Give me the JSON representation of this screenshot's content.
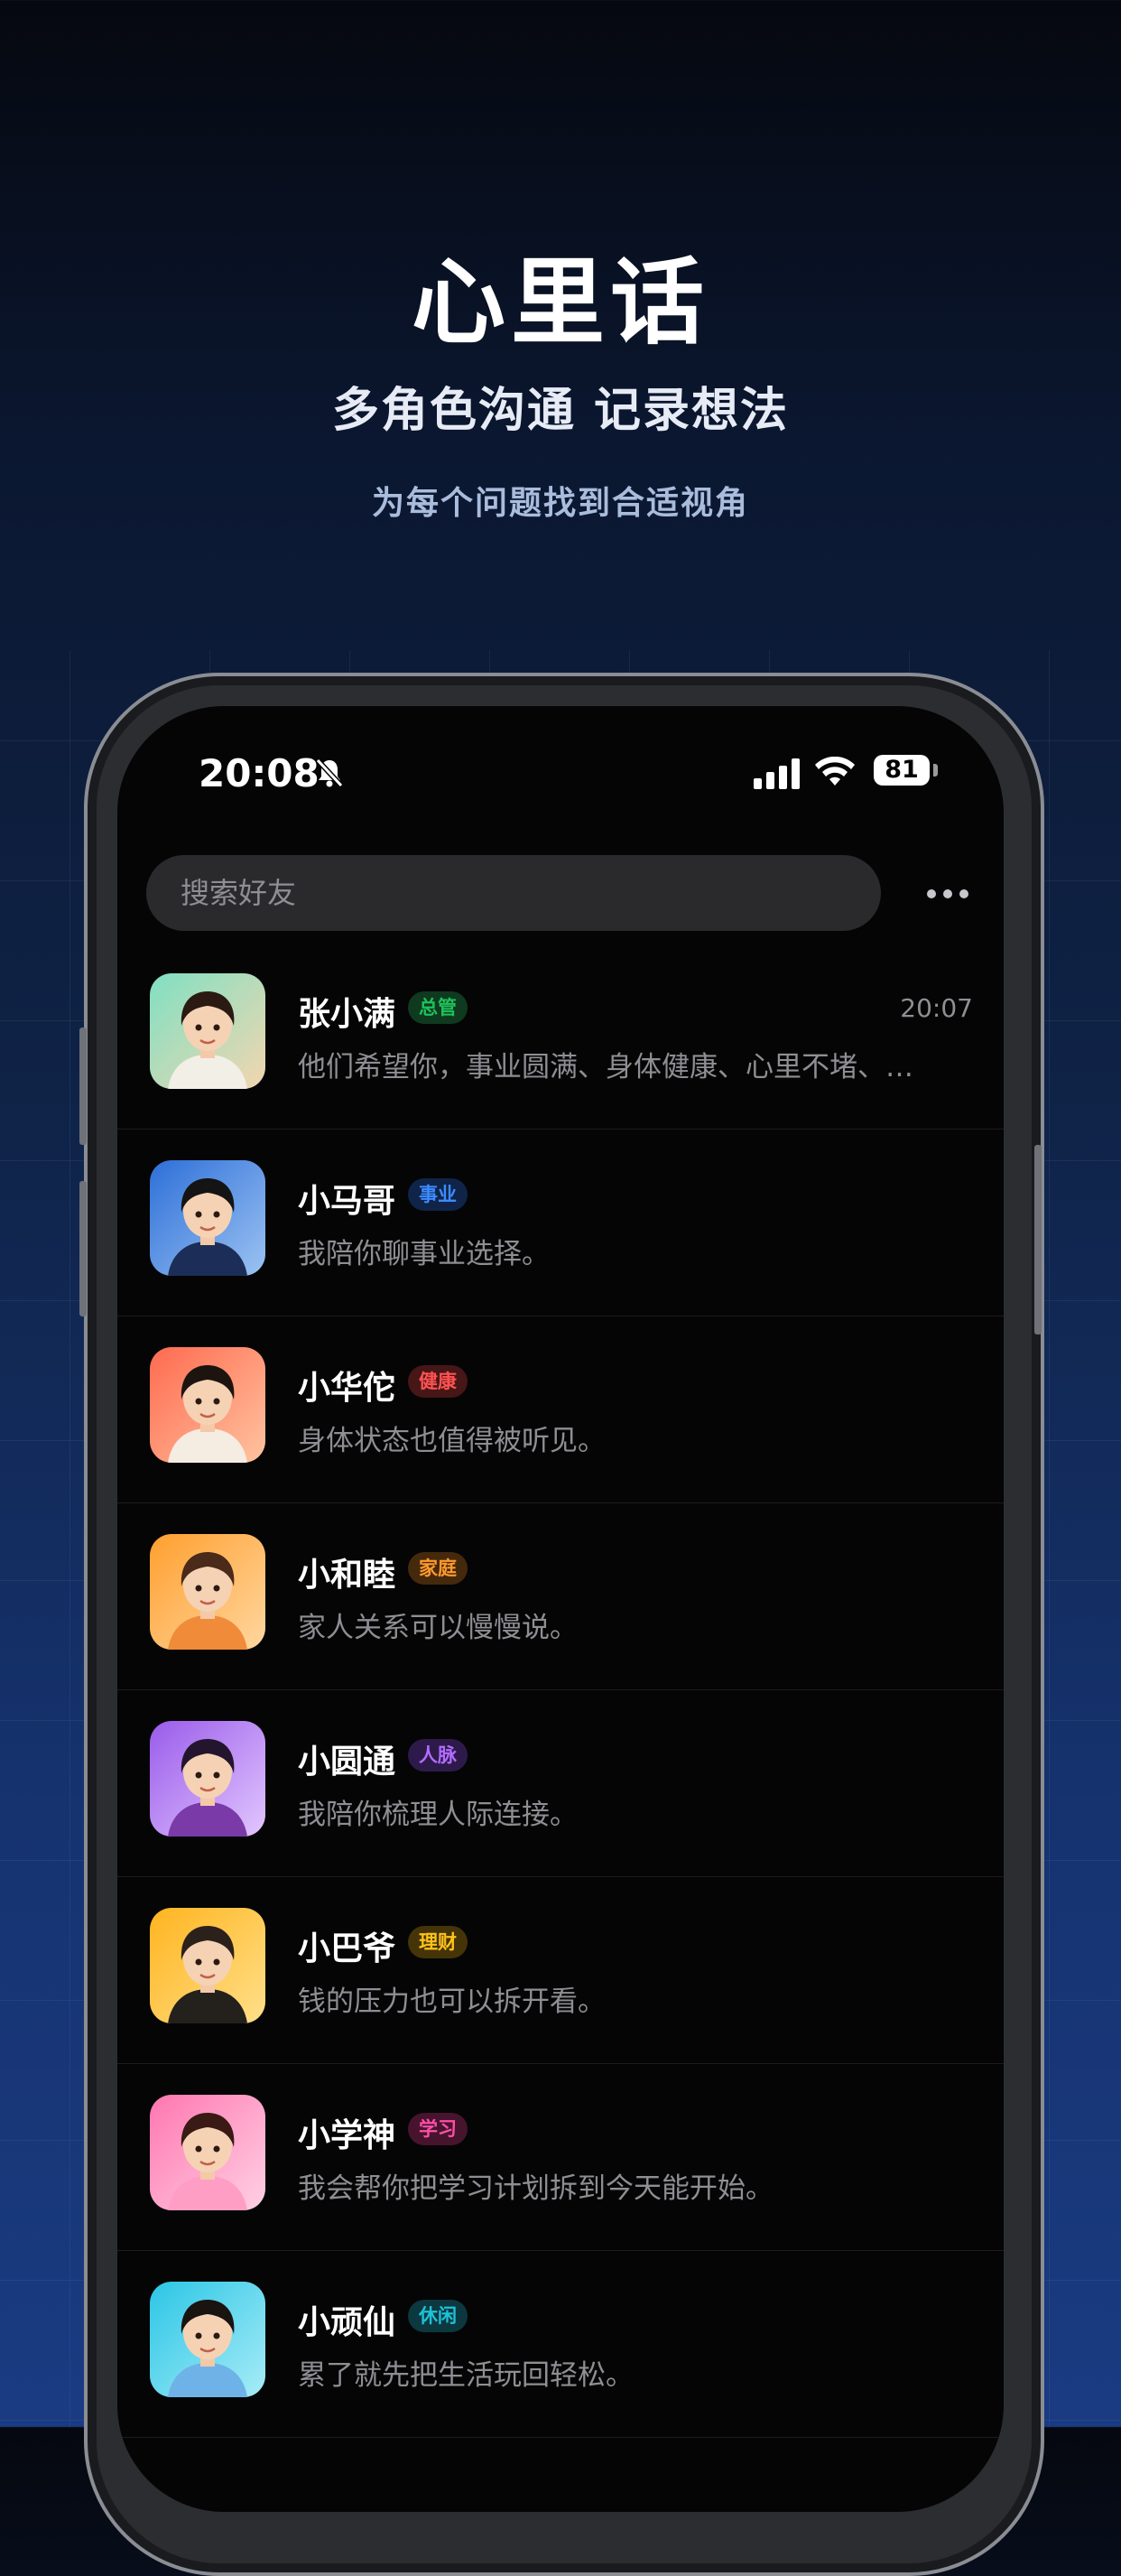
{
  "hero": {
    "title": "心里话",
    "subtitle": "多角色沟通 记录想法",
    "tagline": "为每个问题找到合适视角"
  },
  "status_bar": {
    "time": "20:08",
    "battery": "81",
    "icons": [
      "bell-slash-icon",
      "signal-icon",
      "wifi-icon",
      "battery-icon"
    ]
  },
  "search": {
    "placeholder": "搜索好友"
  },
  "more_icon": "ellipsis-icon",
  "contacts": [
    {
      "name": "张小满",
      "tag": "总管",
      "tag_color": "#1ec25a",
      "tag_bg": "#0f3a1f",
      "message": "他们希望你，事业圆满、身体健康、心里不堵、…",
      "time": "20:07",
      "avatar_bg": [
        "#7fe0c2",
        "#f3d6b0"
      ],
      "hair": "#2a1a12",
      "shirt": "#f2efe6"
    },
    {
      "name": "小马哥",
      "tag": "事业",
      "tag_color": "#3d8bff",
      "tag_bg": "#0f2448",
      "message": "我陪你聊事业选择。",
      "time": "",
      "avatar_bg": [
        "#2d6fd8",
        "#9cc3f2"
      ],
      "hair": "#141414",
      "shirt": "#1c2e57"
    },
    {
      "name": "小华佗",
      "tag": "健康",
      "tag_color": "#ff5252",
      "tag_bg": "#471616",
      "message": "身体状态也值得被听见。",
      "time": "",
      "avatar_bg": [
        "#ff6a4f",
        "#ffc4a0"
      ],
      "hair": "#1d1410",
      "shirt": "#f5ece2"
    },
    {
      "name": "小和睦",
      "tag": "家庭",
      "tag_color": "#ff9a2e",
      "tag_bg": "#45290c",
      "message": "家人关系可以慢慢说。",
      "time": "",
      "avatar_bg": [
        "#ff9f2e",
        "#ffd7a0"
      ],
      "hair": "#4a2a18",
      "shirt": "#f08b3a"
    },
    {
      "name": "小圆通",
      "tag": "人脉",
      "tag_color": "#b26cff",
      "tag_bg": "#2e1a4a",
      "message": "我陪你梳理人际连接。",
      "time": "",
      "avatar_bg": [
        "#9a5bea",
        "#e2c7ff"
      ],
      "hair": "#24152e",
      "shirt": "#7a3aa8"
    },
    {
      "name": "小巴爷",
      "tag": "理财",
      "tag_color": "#ffc21a",
      "tag_bg": "#453408",
      "message": "钱的压力也可以拆开看。",
      "time": "",
      "avatar_bg": [
        "#ffb41f",
        "#ffe08a"
      ],
      "hair": "#2b211a",
      "shirt": "#24201c"
    },
    {
      "name": "小学神",
      "tag": "学习",
      "tag_color": "#ff4fa8",
      "tag_bg": "#47142e",
      "message": "我会帮你把学习计划拆到今天能开始。",
      "time": "",
      "avatar_bg": [
        "#ff76b0",
        "#ffd1e4"
      ],
      "hair": "#3a1a14",
      "shirt": "#ff9ec4"
    },
    {
      "name": "小顽仙",
      "tag": "休闲",
      "tag_color": "#1ec2d8",
      "tag_bg": "#0c3840",
      "message": "累了就先把生活玩回轻松。",
      "time": "",
      "avatar_bg": [
        "#2bc6e6",
        "#a8ecf7"
      ],
      "hair": "#1a1410",
      "shirt": "#6fb2e8"
    }
  ]
}
